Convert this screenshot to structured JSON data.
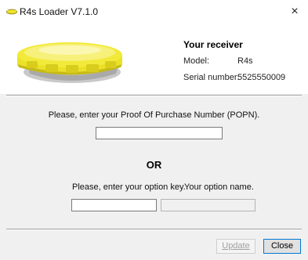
{
  "window": {
    "title": "R4s Loader V7.1.0",
    "close_glyph": "×"
  },
  "receiver": {
    "heading": "Your receiver",
    "model_label": "Model:",
    "model_value": "R4s",
    "serial_label": "Serial number:",
    "serial_value": "5525550009",
    "image_icon": "receiver-image",
    "accent_color": "#f2e62f"
  },
  "popn": {
    "prompt": "Please, enter your Proof Of Purchase Number (POPN).",
    "value": ""
  },
  "or_text": "OR",
  "option": {
    "key_prompt": "Please, enter your option key.",
    "name_prompt": "Your option name.",
    "key_value": "",
    "name_value": ""
  },
  "buttons": {
    "update_label": "Update",
    "close_label": "Close"
  }
}
